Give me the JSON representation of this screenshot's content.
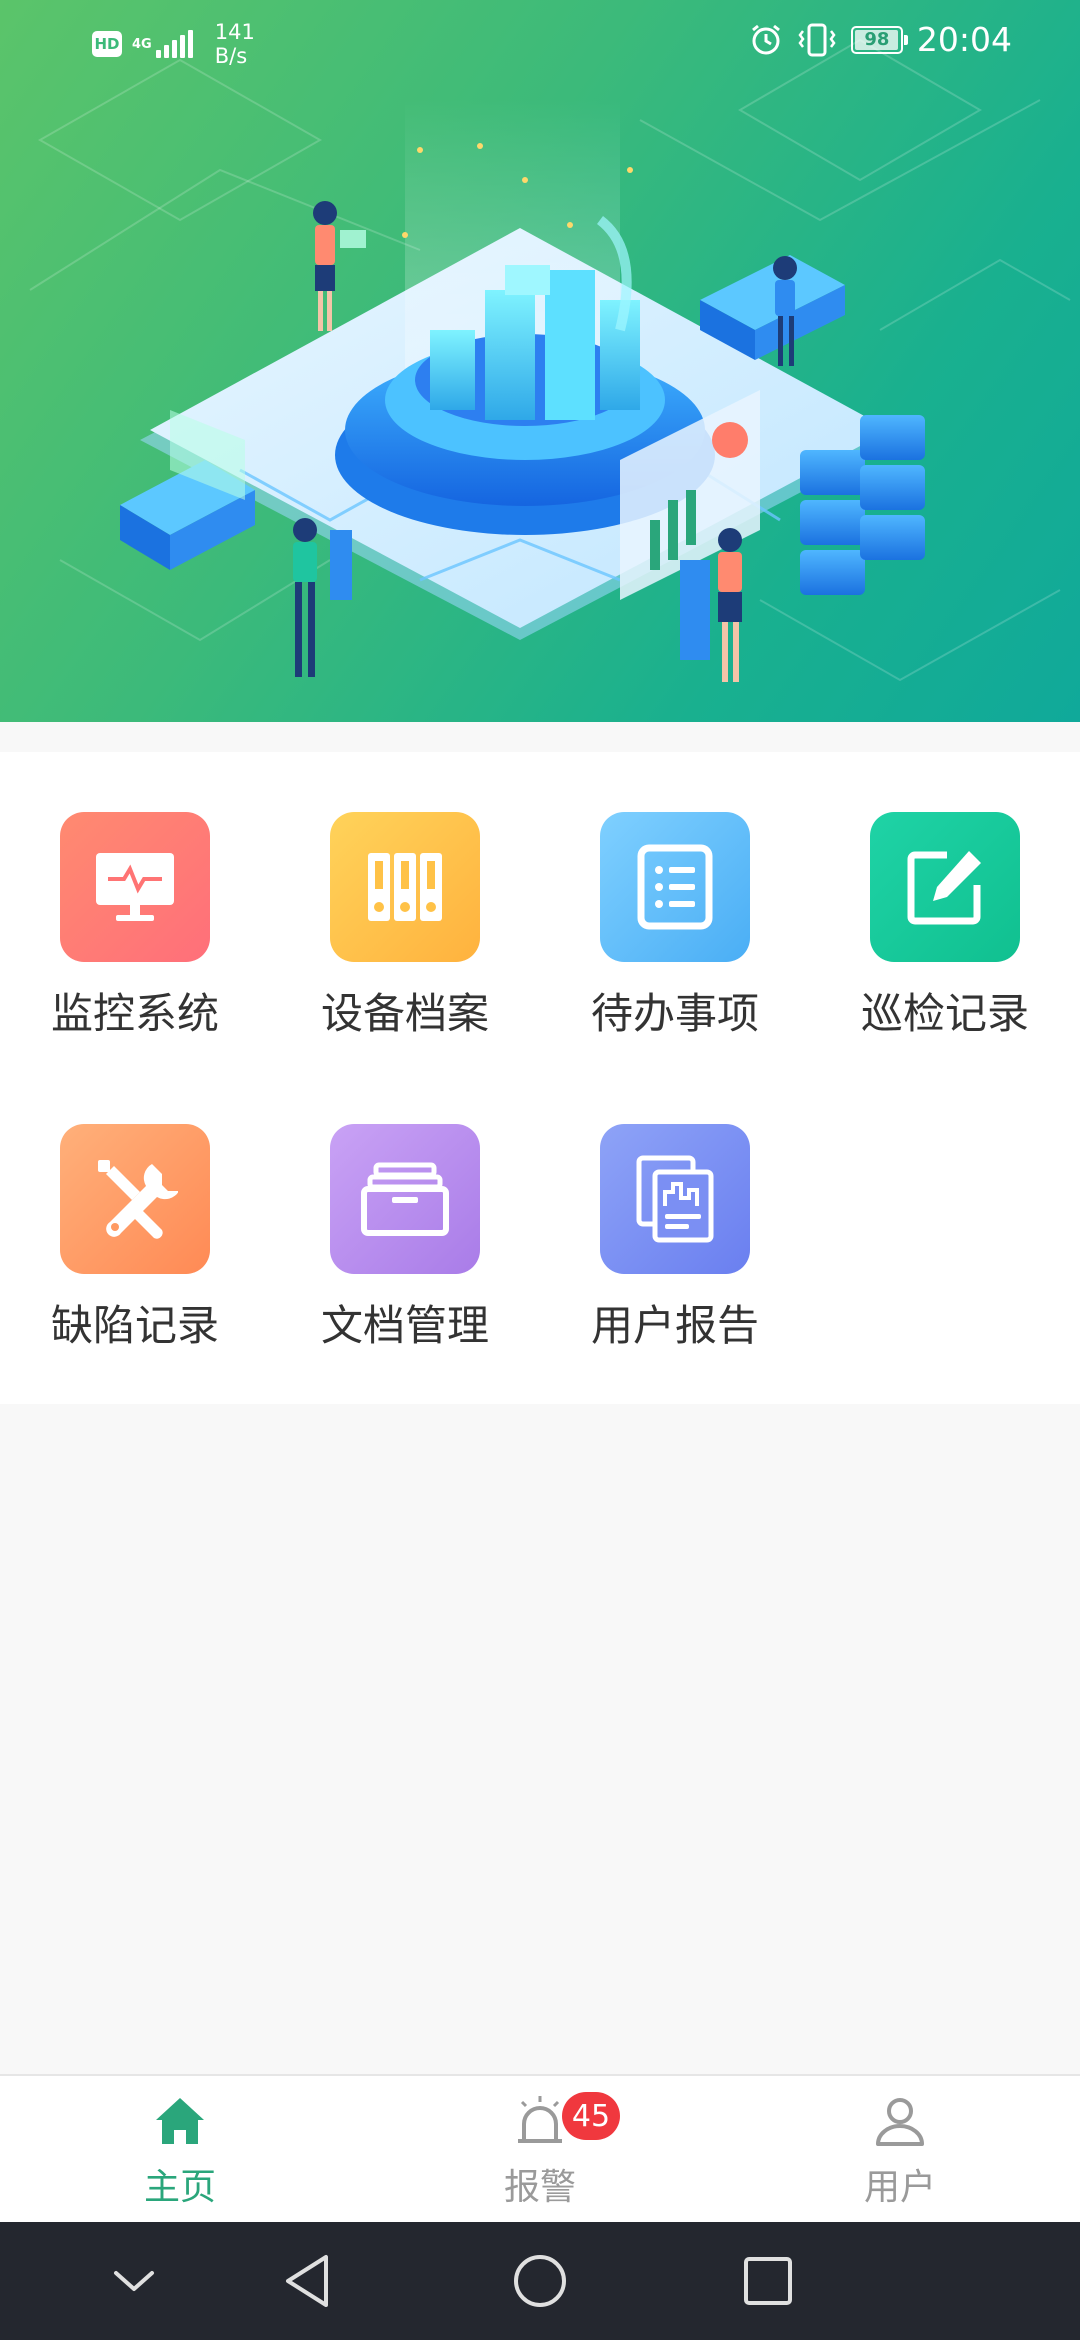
{
  "status_bar": {
    "hd": "HD",
    "network": "4G",
    "speed_value": "141",
    "speed_unit": "B/s",
    "battery_level": "98",
    "battery_fraction": 0.98,
    "time": "20:04",
    "icons": [
      "alarm-icon",
      "vibrate-icon",
      "battery-icon",
      "signal-icon"
    ]
  },
  "banner": {
    "illustration": "isometric-data-center-illustration"
  },
  "menu": {
    "items": [
      {
        "label": "监控系统",
        "icon": "monitor-icon",
        "color_from": "#ff8a70",
        "color_to": "#ff6f7a"
      },
      {
        "label": "设备档案",
        "icon": "binders-icon",
        "color_from": "#ffd35a",
        "color_to": "#ffb23e"
      },
      {
        "label": "待办事项",
        "icon": "checklist-icon",
        "color_from": "#7fd0ff",
        "color_to": "#4aaef5"
      },
      {
        "label": "巡检记录",
        "icon": "edit-icon",
        "color_from": "#1fd3a6",
        "color_to": "#10c090"
      },
      {
        "label": "缺陷记录",
        "icon": "tools-icon",
        "color_from": "#ffb07a",
        "color_to": "#ff8a55"
      },
      {
        "label": "文档管理",
        "icon": "folder-icon",
        "color_from": "#c9a2f5",
        "color_to": "#a97ce8"
      },
      {
        "label": "用户报告",
        "icon": "report-icon",
        "color_from": "#8ea3f7",
        "color_to": "#6a7ff0"
      }
    ]
  },
  "tabs": {
    "home": {
      "label": "主页",
      "active": true,
      "icon": "home-icon"
    },
    "alarm": {
      "label": "报警",
      "badge": "45",
      "icon": "alarm-bell-icon"
    },
    "user": {
      "label": "用户",
      "icon": "user-icon"
    }
  },
  "colors": {
    "accent": "#2aa67b",
    "badge": "#f0383e",
    "inactive": "#9a9a9a"
  },
  "system_nav": {
    "buttons": [
      "collapse-icon",
      "back-icon",
      "home-circle-icon",
      "recents-icon"
    ]
  }
}
